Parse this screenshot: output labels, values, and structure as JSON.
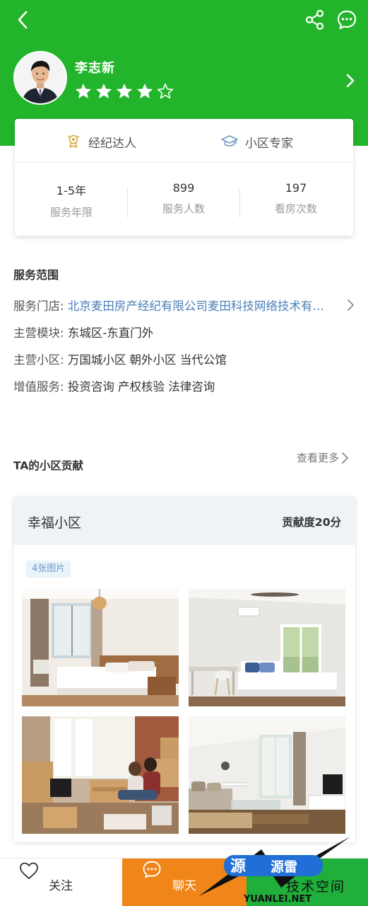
{
  "header": {
    "agent_name": "李志新",
    "rating": {
      "value": 4,
      "max": 5
    }
  },
  "stats_card": {
    "badges": [
      {
        "label": "经纪达人",
        "icon": "trophy-icon"
      },
      {
        "label": "小区专家",
        "icon": "graduation-cap-icon"
      }
    ],
    "stats": [
      {
        "value": "1-5年",
        "label": "服务年限"
      },
      {
        "value": "899",
        "label": "服务人数"
      },
      {
        "value": "197",
        "label": "看房次数"
      }
    ]
  },
  "service_scope": {
    "title": "服务范围",
    "rows": [
      {
        "label": "服务门店: ",
        "value": "北京麦田房产经纪有限公司麦田科技网络技术有限公司"
      },
      {
        "label": "主营模块: ",
        "value": "东城区-东直门外"
      },
      {
        "label": "主营小区: ",
        "value": "万国城小区 朝外小区 当代公馆"
      },
      {
        "label": "增值服务: ",
        "value": "投资咨询 产权核验 法律咨询"
      }
    ]
  },
  "contribution": {
    "title": "TA的小区贡献",
    "more_label": "查看更多",
    "community": {
      "name": "幸福小区",
      "score_label": "贡献度20分",
      "photo_tag": "4张图片"
    }
  },
  "bottom_bar": {
    "follow_label": "关注",
    "chat_label": "聊天"
  },
  "watermark": {
    "text_1": "源",
    "text_2": "源雷",
    "text_3": "技术空间",
    "url": "YUANLEI.NET"
  },
  "colors": {
    "brand_green": "#22b52c",
    "chat_orange": "#f08519",
    "link_blue": "#4a7fb8"
  }
}
